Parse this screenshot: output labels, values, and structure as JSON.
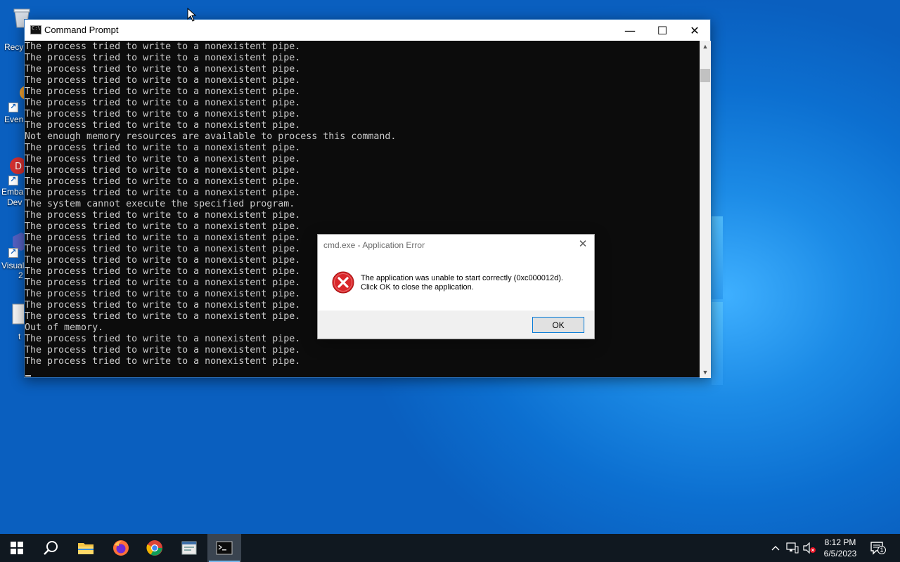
{
  "desktop": {
    "icons": [
      {
        "label": "Recy"
      },
      {
        "label": "Even"
      },
      {
        "label": "Emba"
      },
      {
        "label": "Dev"
      },
      {
        "label": "Visual"
      },
      {
        "label": "2"
      },
      {
        "label": "t"
      }
    ]
  },
  "cmd_window": {
    "title": "Command Prompt",
    "app_icon": "cmd-icon",
    "minimize": "—",
    "maximize": "☐",
    "close": "✕",
    "lines": [
      "The process tried to write to a nonexistent pipe.",
      "The process tried to write to a nonexistent pipe.",
      "The process tried to write to a nonexistent pipe.",
      "The process tried to write to a nonexistent pipe.",
      "The process tried to write to a nonexistent pipe.",
      "The process tried to write to a nonexistent pipe.",
      "The process tried to write to a nonexistent pipe.",
      "The process tried to write to a nonexistent pipe.",
      "Not enough memory resources are available to process this command.",
      "The process tried to write to a nonexistent pipe.",
      "The process tried to write to a nonexistent pipe.",
      "The process tried to write to a nonexistent pipe.",
      "The process tried to write to a nonexistent pipe.",
      "The process tried to write to a nonexistent pipe.",
      "The system cannot execute the specified program.",
      "The process tried to write to a nonexistent pipe.",
      "The process tried to write to a nonexistent pipe.",
      "The process tried to write to a nonexistent pipe.",
      "The process tried to write to a nonexistent pipe.",
      "The process tried to write to a nonexistent pipe.",
      "The process tried to write to a nonexistent pipe.",
      "The process tried to write to a nonexistent pipe.",
      "The process tried to write to a nonexistent pipe.",
      "The process tried to write to a nonexistent pipe.",
      "The process tried to write to a nonexistent pipe.",
      "Out of memory.",
      "The process tried to write to a nonexistent pipe.",
      "The process tried to write to a nonexistent pipe.",
      "The process tried to write to a nonexistent pipe."
    ]
  },
  "error_dialog": {
    "title": "cmd.exe - Application Error",
    "close": "✕",
    "icon": "error-icon",
    "message_line1": "The application was unable to start correctly (0xc000012d).",
    "message_line2": "Click OK to close the application.",
    "ok_label": "OK"
  },
  "taskbar": {
    "items": [
      {
        "name": "start-button",
        "icon": "windows-icon"
      },
      {
        "name": "search-button",
        "icon": "search-icon"
      },
      {
        "name": "file-explorer",
        "icon": "folder-icon"
      },
      {
        "name": "firefox",
        "icon": "firefox-icon"
      },
      {
        "name": "chrome",
        "icon": "chrome-icon"
      },
      {
        "name": "app-window",
        "icon": "window-icon"
      },
      {
        "name": "command-prompt",
        "icon": "cmd-icon",
        "active": true
      }
    ],
    "tray": {
      "chevron": "^",
      "clock_time": "8:12 PM",
      "clock_date": "6/5/2023",
      "notification_count": "1"
    }
  },
  "colors": {
    "console_bg": "#0c0c0c",
    "console_fg": "#cccccc",
    "error_red": "#d9262a",
    "accent": "#0078d7",
    "taskbar": "#101820"
  }
}
